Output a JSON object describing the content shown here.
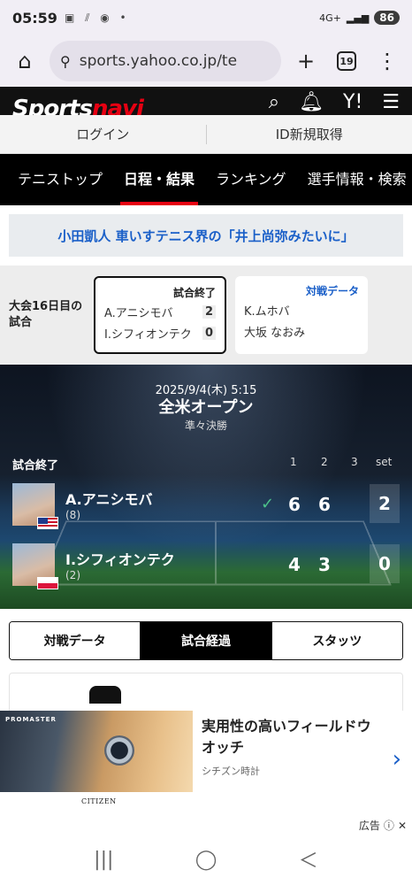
{
  "status_bar": {
    "time": "05:59",
    "icons": "▣ ⫽ ◉ •",
    "network": "4G+",
    "battery": "86"
  },
  "browser": {
    "url": "sports.yahoo.co.jp/te",
    "tab_count": "19"
  },
  "site": {
    "logo_a": "Sports",
    "logo_b": "navi"
  },
  "account": {
    "login": "ログイン",
    "register": "ID新規取得"
  },
  "tennis_nav": [
    "テニストップ",
    "日程・結果",
    "ランキング",
    "選手情報・検索"
  ],
  "headline": "小田凱人 車いすテニス界の「井上尚弥みたいに」",
  "matches": {
    "day_label_1": "大会16日目の",
    "day_label_2": "試合",
    "card1": {
      "status": "試合終了",
      "p1": "A.アニシモバ",
      "s1": "2",
      "p2": "I.シフィオンテク",
      "s2": "0"
    },
    "card2": {
      "status": "対戦データ",
      "p1": "K.ムホバ",
      "p2": "大坂 なおみ"
    }
  },
  "scoreboard": {
    "datetime": "2025/9/4(木) 5:15",
    "tournament": "全米オープン",
    "round": "準々決勝",
    "status": "試合終了",
    "set_headers": [
      "1",
      "2",
      "3",
      "set"
    ],
    "players": [
      {
        "name": "A.アニシモバ",
        "seed": "(8)",
        "s1": "6",
        "s2": "6",
        "s3": "",
        "sets": "2"
      },
      {
        "name": "I.シフィオンテク",
        "seed": "(2)",
        "s1": "4",
        "s2": "3",
        "s3": "",
        "sets": "0"
      }
    ]
  },
  "tabs": [
    "対戦データ",
    "試合経過",
    "スタッツ"
  ],
  "ad": {
    "brand": "PROMASTER",
    "caption": "CITIZEN",
    "title_1": "実用性の高いフィールドウ",
    "title_2": "オッチ",
    "sponsor": "シチズン時計",
    "label": "広告"
  },
  "system_nav": {
    "recents": "|||",
    "home": "◯",
    "back": "＜"
  }
}
